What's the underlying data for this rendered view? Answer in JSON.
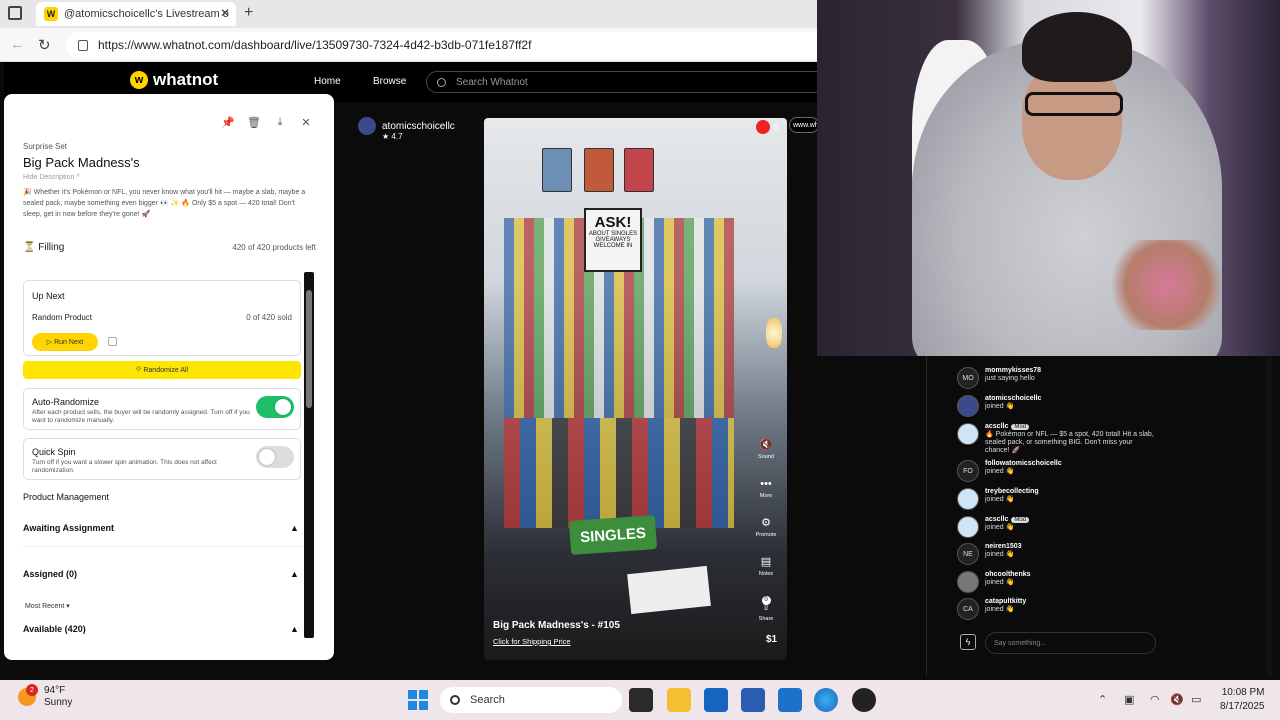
{
  "browser": {
    "tab_title": "@atomicschoicellc's Livestream o",
    "tab_favicon": "W",
    "url": "https://www.whatnot.com/dashboard/live/13509730-7324-4d42-b3db-071fe187ff2f"
  },
  "whatnot_header": {
    "brand": "whatnot",
    "nav": [
      "Home",
      "Browse"
    ],
    "search_placeholder": "Search Whatnot"
  },
  "product_panel": {
    "type": "Surprise Set",
    "title": "Big Pack Madness's",
    "hide_description": "Hide Description ^",
    "description": "🎉 Whether it's Pokémon or NFL, you never know what you'll hit — maybe a slab, maybe a sealed pack, maybe something even bigger 👀 ✨ 🔥 Only $5 a spot — 420 total! Don't sleep, get in now before they're gone! 🚀",
    "status": "Filling",
    "products_left": "420 of 420 products left",
    "up_next": {
      "heading": "Up Next",
      "product": "Random Product",
      "sold": "0 of 420 sold",
      "run_label": "Run Next"
    },
    "randomize_label": "Randomize All",
    "auto_randomize": {
      "title": "Auto-Randomize",
      "desc": "After each product sells, the buyer will be randomly assigned. Turn off if you want to randomize manually.",
      "on": true
    },
    "quick_spin": {
      "title": "Quick Spin",
      "desc": "Turn off if you want a slower spin animation. This does not affect randomization.",
      "on": false
    },
    "product_management": "Product Management",
    "awaiting_assignment": "Awaiting Assignment",
    "assigned": "Assigned (0)",
    "most_recent": "Most Recent",
    "available": "Available (420)"
  },
  "stream": {
    "streamer": "atomicschoicellc",
    "rating": "4.7",
    "viewers": "5",
    "pill_text": "www.wh",
    "controls": [
      {
        "icon": "sound-icon",
        "glyph": "🔇",
        "label": "Sound"
      },
      {
        "icon": "more-icon",
        "glyph": "•••",
        "label": "More"
      },
      {
        "icon": "promote-icon",
        "glyph": "⚙",
        "label": "Promote"
      },
      {
        "icon": "notes-icon",
        "glyph": "▤",
        "label": "Notes"
      },
      {
        "icon": "share-icon",
        "glyph": "⇧",
        "label": "Share"
      }
    ],
    "share_count": "0",
    "product_title": "Big Pack Madness's - #105",
    "shipping_link": "Click for Shipping Price",
    "price": "$1",
    "scene_sign_title": "ASK!",
    "scene_sign_text": "ABOUT SINGLES GIVEAWAYS WELCOME IN",
    "scene_singles": "SINGLES"
  },
  "chat": {
    "messages": [
      {
        "avatar": "MO",
        "user": "mommykisses78",
        "text": "just saying hello",
        "mod": false
      },
      {
        "avatar": "",
        "user": "atomicschoicellc",
        "text": "joined 👋",
        "mod": false
      },
      {
        "avatar": "",
        "user": "acscllc",
        "text": "🔥 Pokémon or NFL — $5 a spot, 420 total! Hit a slab, sealed pack, or something BIG. Don't miss your chance! 🚀",
        "mod": true
      },
      {
        "avatar": "FO",
        "user": "followatomicschoicellc",
        "text": "joined 👋",
        "mod": false
      },
      {
        "avatar": "",
        "user": "treybecollecting",
        "text": "joined 👋",
        "mod": false
      },
      {
        "avatar": "",
        "user": "acscllc",
        "text": "joined 👋",
        "mod": true
      },
      {
        "avatar": "NE",
        "user": "neiren1503",
        "text": "joined 👋",
        "mod": false
      },
      {
        "avatar": "",
        "user": "ohcoolthenks",
        "text": "joined 👋",
        "mod": false
      },
      {
        "avatar": "CA",
        "user": "catapultkitty",
        "text": "joined 👋",
        "mod": false
      }
    ],
    "mod_label": "Mod",
    "input_placeholder": "Say something..."
  },
  "taskbar": {
    "weather_badge": "2",
    "temperature": "94°F",
    "condition": "Sunny",
    "search": "Search",
    "time": "10:08 PM",
    "date": "8/17/2025"
  },
  "colors": {
    "accent_yellow": "#ffd400",
    "toggle_on": "#1fbf6a",
    "toggle_off": "#dddddd"
  }
}
